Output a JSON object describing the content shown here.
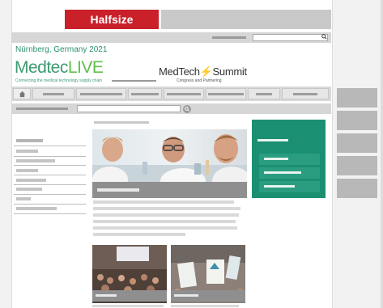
{
  "banner": {
    "label": "Halfsize"
  },
  "header": {
    "location": "Nürnberg, Germany 2021"
  },
  "logo_left": {
    "name_main": "Medtec",
    "name_accent": "LIVE",
    "tagline": "Connecting the medical technology supply chain"
  },
  "logo_right": {
    "name_a": "MedTech",
    "name_b": "Summit",
    "subtitle": "Congress and Partnering"
  },
  "icons": {
    "search": "search-icon",
    "home": "home-icon",
    "go": "go-icon"
  },
  "colors": {
    "brand_red": "#c9202a",
    "brand_green": "#1b8f71",
    "logo_green": "#3d9a70"
  }
}
